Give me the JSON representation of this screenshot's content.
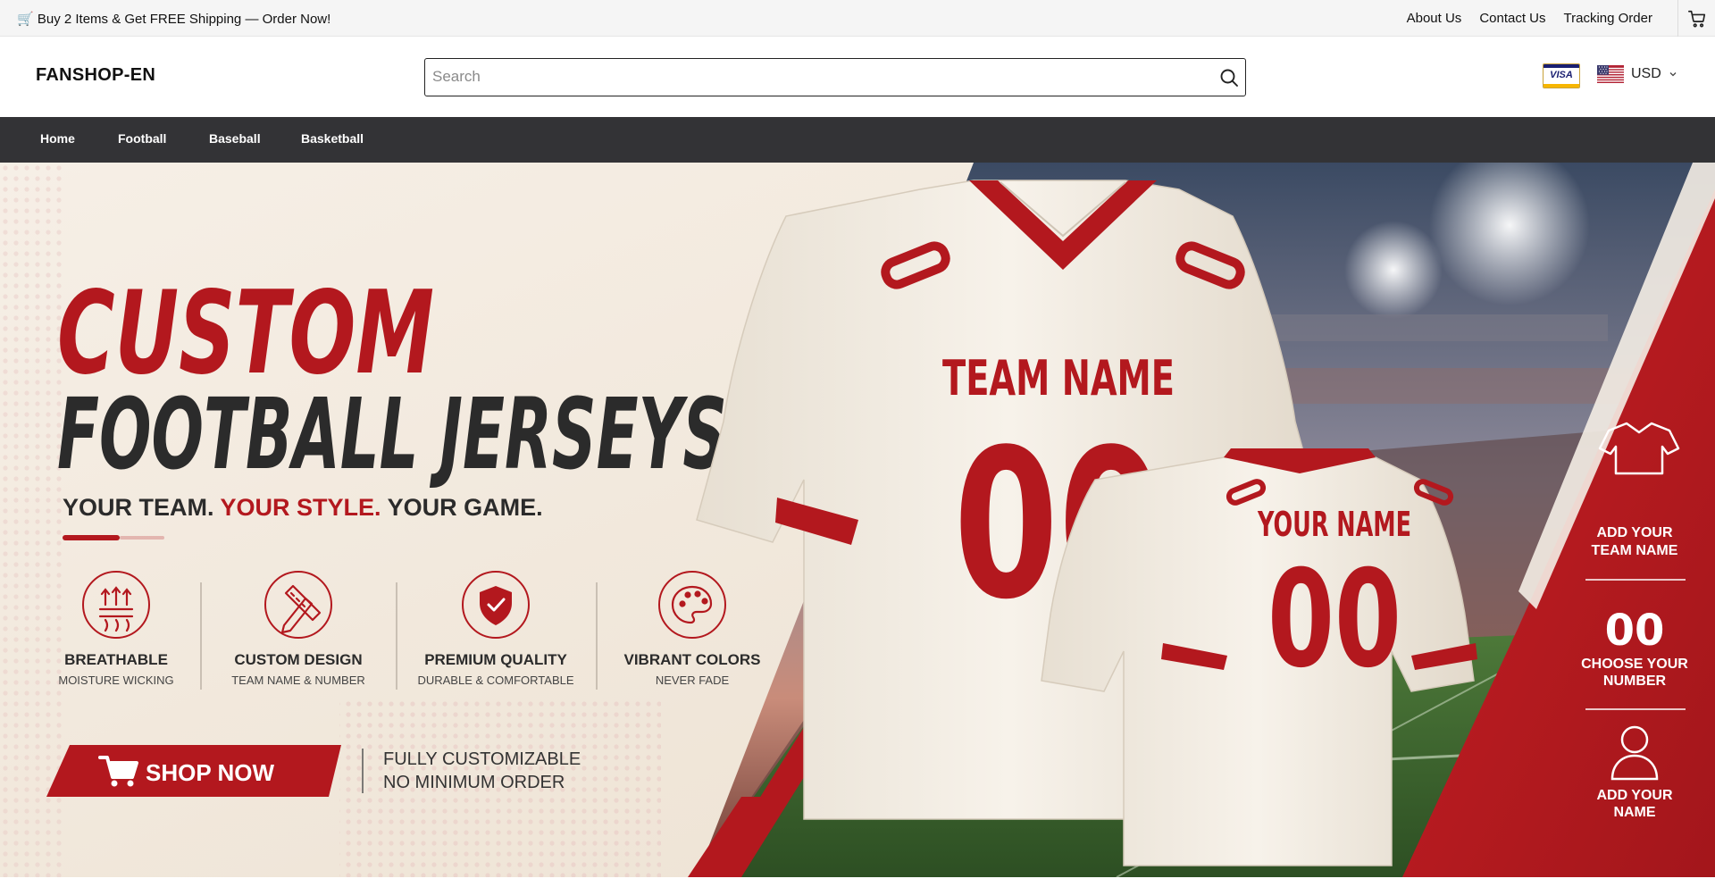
{
  "announcement": "🛒 Buy 2 Items & Get FREE Shipping — Order Now!",
  "top_links": [
    "About Us",
    "Contact Us",
    "Tracking Order"
  ],
  "brand": "FANSHOP-EN",
  "search": {
    "placeholder": "Search",
    "value": ""
  },
  "payment_badge": "VISA",
  "currency": {
    "label": "USD"
  },
  "nav": {
    "items": [
      "Home",
      "Football",
      "Baseball",
      "Basketball"
    ]
  },
  "hero": {
    "title_line1": "CUSTOM",
    "title_line2": "FOOTBALL JERSEYS",
    "tagline_1": "YOUR TEAM. ",
    "tagline_2": "YOUR STYLE. ",
    "tagline_3": "YOUR GAME.",
    "features": [
      {
        "title": "BREATHABLE",
        "subtitle": "MOISTURE WICKING",
        "icon": "breathable-icon"
      },
      {
        "title": "CUSTOM DESIGN",
        "subtitle": "TEAM NAME & NUMBER",
        "icon": "pencil-ruler-icon"
      },
      {
        "title": "PREMIUM QUALITY",
        "subtitle": "DURABLE & COMFORTABLE",
        "icon": "shield-check-icon"
      },
      {
        "title": "VIBRANT COLORS",
        "subtitle": "NEVER FADE",
        "icon": "palette-icon"
      }
    ],
    "cta": "SHOP NOW",
    "cta_note_1": "FULLY CUSTOMIZABLE",
    "cta_note_2": "NO MINIMUM ORDER",
    "jersey_big": {
      "team": "TEAM NAME",
      "number": "00"
    },
    "jersey_small": {
      "name": "YOUR NAME",
      "number": "00"
    },
    "steps": [
      {
        "line1": "ADD YOUR",
        "line2": "TEAM NAME",
        "icon": "shirt-icon"
      },
      {
        "line1": "CHOOSE YOUR",
        "line2": "NUMBER",
        "icon": "number-icon",
        "glyph": "00"
      },
      {
        "line1": "ADD YOUR",
        "line2": "NAME",
        "icon": "person-icon"
      }
    ]
  },
  "colors": {
    "accent_red": "#b3181e",
    "nav_bg": "#333336",
    "cream": "#f1e8dc",
    "dark_text": "#2b2b2b"
  }
}
